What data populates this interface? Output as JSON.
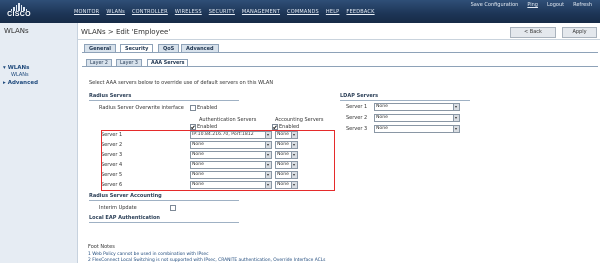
{
  "brand": {
    "logo_text": "CISCO"
  },
  "top_nav": [
    "MONITOR",
    "WLANs",
    "CONTROLLER",
    "WIRELESS",
    "SECURITY",
    "MANAGEMENT",
    "COMMANDS",
    "HELP",
    "FEEDBACK"
  ],
  "top_links": {
    "save": "Save Configuration",
    "ping": "Ping",
    "logout": "Logout",
    "refresh": "Refresh"
  },
  "sidebar": {
    "title": "WLANs",
    "items": [
      {
        "label": "WLANs",
        "sub": "WLANs"
      },
      {
        "label": "Advanced"
      }
    ]
  },
  "page": {
    "title": "WLANs > Edit  'Employee'",
    "back_label": "< Back",
    "apply_label": "Apply"
  },
  "tabs": [
    "General",
    "Security",
    "QoS",
    "Advanced"
  ],
  "subtabs": [
    "Layer 2",
    "Layer 3",
    "AAA Servers"
  ],
  "aaa": {
    "intro": "Select AAA servers below to override use of default servers on this WLAN",
    "radius_title": "Radius Servers",
    "overwrite_label": "Radius Server Overwrite interface",
    "overwrite_value": "Enabled",
    "auth_header": "Authentication Servers",
    "acct_header": "Accounting Servers",
    "auth_enabled_label": "Enabled",
    "acct_enabled_label": "Enabled",
    "servers": [
      {
        "label": "Server 1",
        "auth": "IP:10.84.216.70, Port:1812",
        "acct": "None"
      },
      {
        "label": "Server 2",
        "auth": "None",
        "acct": "None"
      },
      {
        "label": "Server 3",
        "auth": "None",
        "acct": "None"
      },
      {
        "label": "Server 4",
        "auth": "None",
        "acct": "None"
      },
      {
        "label": "Server 5",
        "auth": "None",
        "acct": "None"
      },
      {
        "label": "Server 6",
        "auth": "None",
        "acct": "None"
      }
    ],
    "accounting_title": "Radius Server Accounting",
    "interim_label": "Interim Update",
    "local_eap_title": "Local EAP Authentication",
    "ldap_title": "LDAP Servers",
    "ldap": [
      {
        "label": "Server 1",
        "value": "None"
      },
      {
        "label": "Server 2",
        "value": "None"
      },
      {
        "label": "Server 3",
        "value": "None"
      }
    ]
  },
  "footnotes": {
    "title": "Foot Notes",
    "lines": [
      "1 Web Policy cannot be used in combination with IPsec",
      "2 FlexConnect Local Switching is not supported with IPsec, CRANITE authentication, Override Interface ACLs"
    ]
  },
  "colors": {
    "header_bg": "#1d3556",
    "highlight_box": "#e52b2b",
    "link": "#1f4a7c"
  }
}
